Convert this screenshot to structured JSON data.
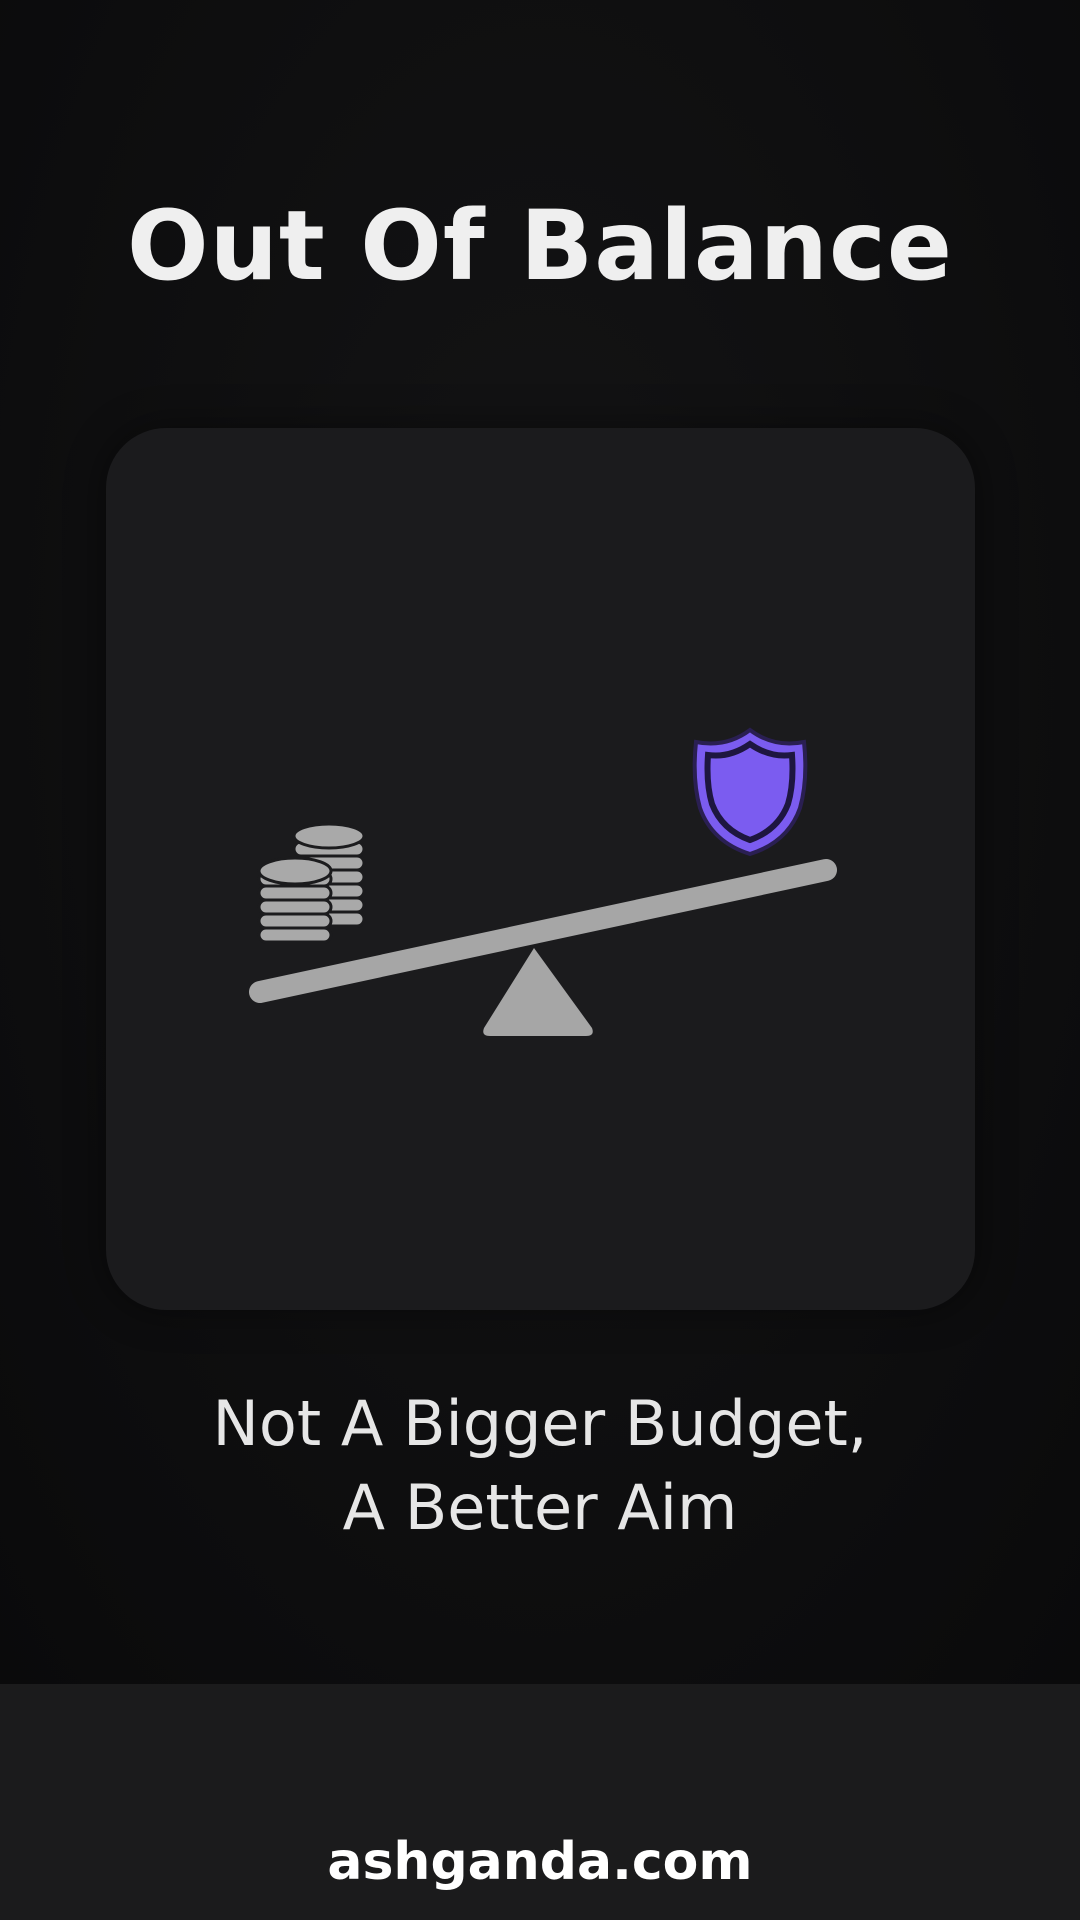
{
  "title": "Out Of Balance",
  "subtitle": {
    "line1": "Not A Bigger Budget,",
    "line2": "A Better Aim"
  },
  "illustration": {
    "left_icon": "coin-stack-icon",
    "right_icon": "shield-icon",
    "fulcrum_icon": "triangle-fulcrum-icon",
    "beam_color": "#a6a6a6",
    "shield_color": "#7b5cf0",
    "coin_color": "#a9a9a9"
  },
  "colors": {
    "background": "#0e0e0f",
    "card": "#1b1b1d",
    "text": "#efefef",
    "accent": "#7b5cf0"
  },
  "footer": {
    "url": "ashganda.com"
  }
}
